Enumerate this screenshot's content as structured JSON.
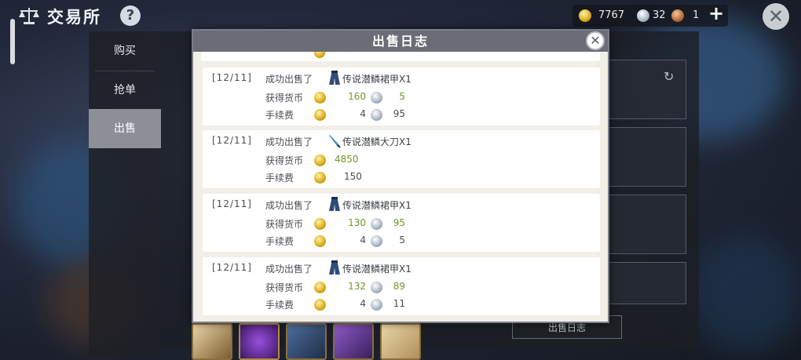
{
  "header": {
    "title": "交易所",
    "help_icon": "question-mark",
    "currency": {
      "gold": "7767",
      "silver": "32",
      "bronze": "1"
    }
  },
  "side_nav": {
    "items": [
      {
        "label": "购买"
      },
      {
        "label": "抢单"
      },
      {
        "label": "出售"
      }
    ],
    "active_index": 2
  },
  "right_panel": {
    "sale_log_button": "出售日志"
  },
  "modal": {
    "title": "出售日志",
    "entries": [
      {
        "date": "[12/11]",
        "action": "成功出售了",
        "item": "传说潜鳞裙甲X1",
        "item_icon": "armor-skirt-icon",
        "earned_label": "获得货币",
        "earned_gold": "160",
        "earned_silver": "5",
        "fee_label": "手续费",
        "fee_gold": "4",
        "fee_silver": "95"
      },
      {
        "date": "[12/11]",
        "action": "成功出售了",
        "item": "传说潜鳞大刀X1",
        "item_icon": "blade-icon",
        "earned_label": "获得货币",
        "earned_gold": "4850",
        "earned_silver": "",
        "fee_label": "手续费",
        "fee_gold": "150",
        "fee_silver": ""
      },
      {
        "date": "[12/11]",
        "action": "成功出售了",
        "item": "传说潜鳞裙甲X1",
        "item_icon": "armor-skirt-icon",
        "earned_label": "获得货币",
        "earned_gold": "130",
        "earned_silver": "95",
        "fee_label": "手续费",
        "fee_gold": "4",
        "fee_silver": "5"
      },
      {
        "date": "[12/11]",
        "action": "成功出售了",
        "item": "传说潜鳞裙甲X1",
        "item_icon": "armor-skirt-icon",
        "earned_label": "获得货币",
        "earned_gold": "132",
        "earned_silver": "89",
        "fee_label": "手续费",
        "fee_gold": "4",
        "fee_silver": "11"
      }
    ]
  }
}
